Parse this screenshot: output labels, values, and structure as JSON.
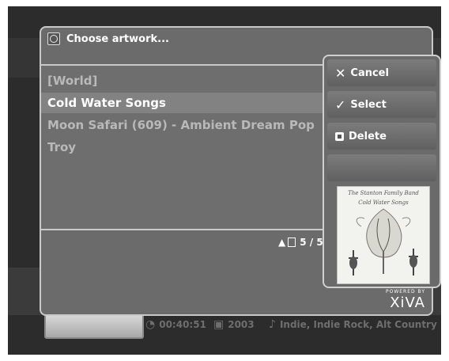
{
  "dialog": {
    "title": "Choose artwork...",
    "items": [
      {
        "label": "[World]",
        "selected": false
      },
      {
        "label": "Cold Water Songs",
        "selected": true
      },
      {
        "label": "Moon Safari (609) - Ambient Dream Pop",
        "selected": false
      },
      {
        "label": "Troy",
        "selected": false
      }
    ],
    "page_indicator": "5 / 5"
  },
  "menu": {
    "cancel": "Cancel",
    "select": "Select",
    "delete": "Delete"
  },
  "artwork": {
    "line1": "The Stanton Family Band",
    "line2": "Cold Water Songs"
  },
  "logo": {
    "powered_by": "POWERED BY",
    "brand": "XiVA"
  },
  "background": {
    "duration": "00:40:51",
    "year": "2003",
    "genre": "Indie, Indie Rock, Alt Country"
  }
}
